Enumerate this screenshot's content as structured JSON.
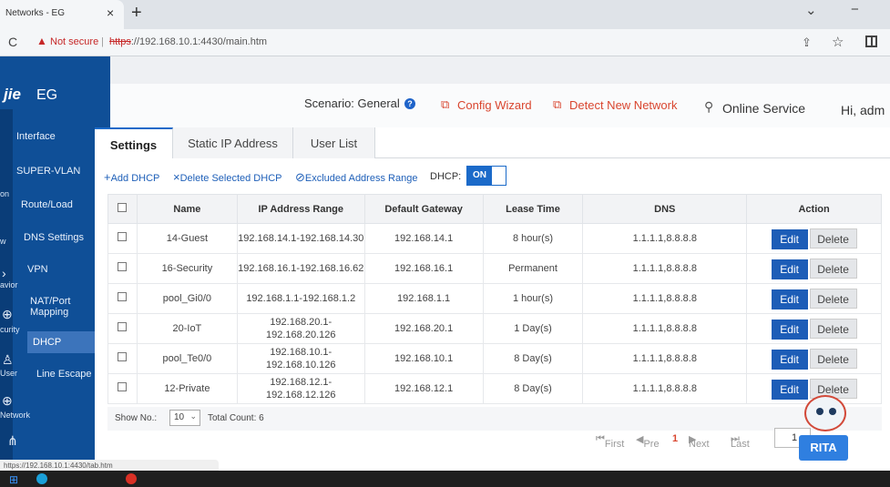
{
  "browser": {
    "tab_title": "Networks - EG",
    "tab_close": "×",
    "new_tab": "+",
    "reload": "C",
    "not_secure": "Not secure",
    "url_scheme": "https",
    "url_rest": "://192.168.10.1:4430/main.htm",
    "status_url": "https://192.168.10.1:4430/tab.htm"
  },
  "sidebar": {
    "logo": "jie",
    "model": "EG",
    "items": [
      {
        "label": "Interface"
      },
      {
        "label": "SUPER-VLAN"
      },
      {
        "label": "Route/Load"
      },
      {
        "label": "DNS Settings"
      },
      {
        "label": "VPN"
      },
      {
        "label": "NAT/Port Mapping"
      },
      {
        "label": "DHCP"
      },
      {
        "label": "Line Escape"
      }
    ],
    "side_fragments": [
      "on",
      "w",
      "avior",
      "curity",
      "User",
      "Network"
    ]
  },
  "header": {
    "scenario_label": "Scenario:",
    "scenario_value": "General",
    "help": "?",
    "config_wizard": "Config Wizard",
    "detect_network": "Detect New Network",
    "online_service": "Online Service",
    "greeting": "Hi, adm"
  },
  "tabs": [
    "Settings",
    "Static IP Address",
    "User List"
  ],
  "toolbar": {
    "add": "Add DHCP",
    "delete_selected": "Delete Selected DHCP",
    "excluded": "Excluded Address Range",
    "dhcp_label": "DHCP:",
    "dhcp_state": "ON"
  },
  "table": {
    "columns": [
      "Name",
      "IP Address Range",
      "Default Gateway",
      "Lease Time",
      "DNS",
      "Action"
    ],
    "rows": [
      {
        "name": "14-Guest",
        "range": "192.168.14.1-192.168.14.30",
        "gateway": "192.168.14.1",
        "lease": "8 hour(s)",
        "dns": "1.1.1.1,8.8.8.8"
      },
      {
        "name": "16-Security",
        "range": "192.168.16.1-192.168.16.62",
        "gateway": "192.168.16.1",
        "lease": "Permanent",
        "dns": "1.1.1.1,8.8.8.8"
      },
      {
        "name": "pool_Gi0/0",
        "range": "192.168.1.1-192.168.1.2",
        "gateway": "192.168.1.1",
        "lease": "1 hour(s)",
        "dns": "1.1.1.1,8.8.8.8"
      },
      {
        "name": "20-IoT",
        "range": "192.168.20.1-192.168.20.126",
        "gateway": "192.168.20.1",
        "lease": "1 Day(s)",
        "dns": "1.1.1.1,8.8.8.8"
      },
      {
        "name": "pool_Te0/0",
        "range": "192.168.10.1-192.168.10.126",
        "gateway": "192.168.10.1",
        "lease": "8 Day(s)",
        "dns": "1.1.1.1,8.8.8.8"
      },
      {
        "name": "12-Private",
        "range": "192.168.12.1-192.168.12.126",
        "gateway": "192.168.12.1",
        "lease": "8 Day(s)",
        "dns": "1.1.1.1,8.8.8.8"
      }
    ],
    "edit_label": "Edit",
    "delete_label": "Delete"
  },
  "footer": {
    "show_label": "Show No.:",
    "page_size": "10",
    "total": "Total Count: 6"
  },
  "pager": {
    "first": "First",
    "prev": "Pre",
    "current": "1",
    "next": "Next",
    "last": "Last",
    "input_value": "1"
  },
  "assistant": {
    "label": "RITA"
  }
}
